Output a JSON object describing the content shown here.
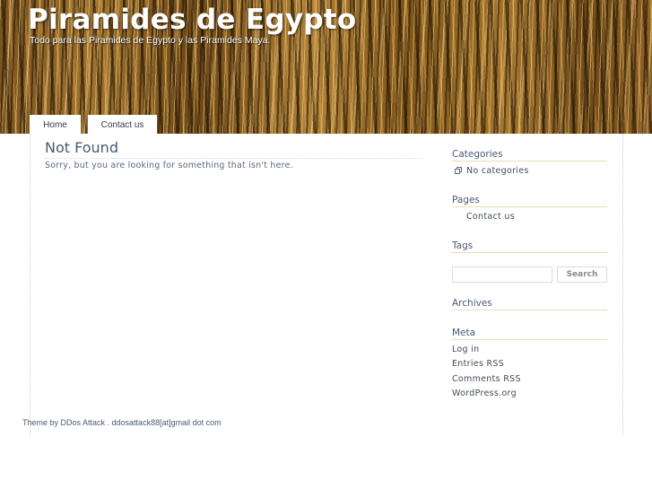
{
  "header": {
    "site_title": "Piramides de Egypto",
    "site_description": "Todo para las Piramides de Egypto y las Piramides Maya."
  },
  "nav": {
    "items": [
      {
        "label": "Home"
      },
      {
        "label": "Contact us"
      }
    ]
  },
  "main": {
    "title": "Not Found",
    "message": "Sorry, but you are looking for something that isn't here."
  },
  "sidebar": {
    "categories": {
      "title": "Categories",
      "empty_text": "No categories"
    },
    "pages": {
      "title": "Pages",
      "items": [
        "Contact us"
      ]
    },
    "tags": {
      "title": "Tags",
      "search_placeholder": "",
      "search_button": "Search"
    },
    "archives": {
      "title": "Archives"
    },
    "meta": {
      "title": "Meta",
      "items": [
        "Log in",
        "Entries RSS",
        "Comments RSS",
        "WordPress.org"
      ]
    }
  },
  "footer": {
    "text": "Theme by DDos Attack . ddosattack88[at]gmail dot com"
  },
  "colors": {
    "heading": "#4a5a73",
    "body_text": "#444c59",
    "widget_rule": "#eadcb8"
  }
}
